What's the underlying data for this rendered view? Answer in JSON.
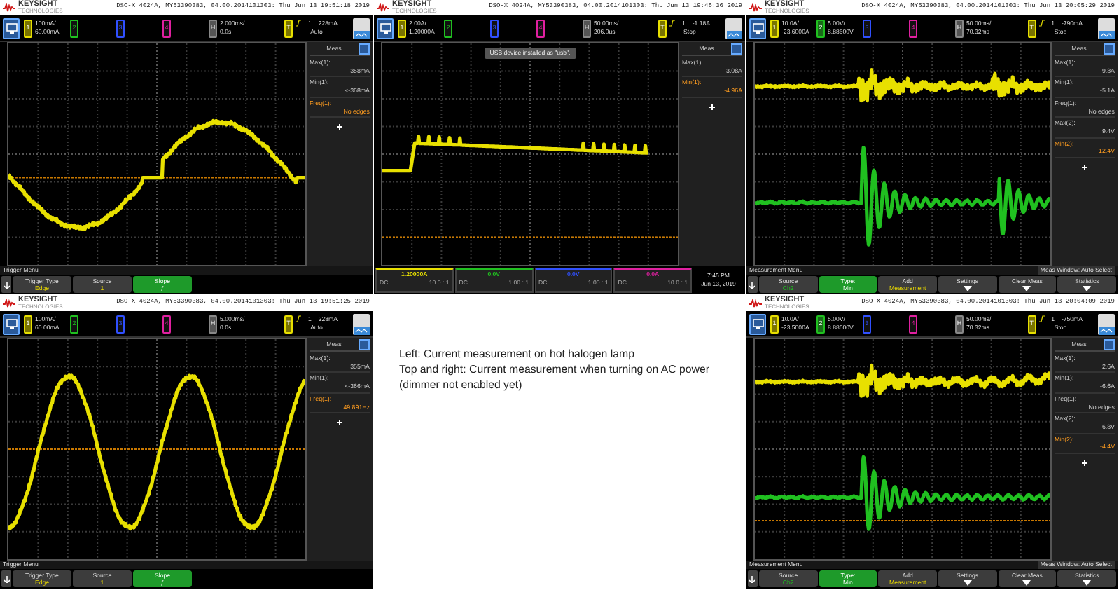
{
  "screenshots": [
    {
      "logo": {
        "brand": "KEYSIGHT",
        "tagline": "TECHNOLOGIES"
      },
      "title": "DSO-X 4024A, MY53390383, 04.00.2014101303: Thu Jun 13 19:51:18 2019",
      "channels": [
        {
          "label": "1",
          "on": true,
          "color": "#e8e000",
          "values": [
            "100mA/",
            "60.00mA"
          ]
        },
        {
          "label": "2",
          "on": false,
          "color": "#20c020"
        },
        {
          "label": "3",
          "on": false,
          "color": "#3050ff"
        },
        {
          "label": "4",
          "on": false,
          "color": "#e020a0"
        }
      ],
      "horizontal": {
        "label": "H",
        "values": [
          "2.000ms/",
          "0.0s"
        ]
      },
      "trigger": {
        "label": "T",
        "source": "1",
        "level": "228mA",
        "mode": "Auto"
      },
      "measurements": {
        "title": "Meas",
        "items": [
          {
            "label": "Max(1):",
            "value": "358mA",
            "highlighted": false
          },
          {
            "label": "Min(1):",
            "value": "<-368mA",
            "highlighted": false
          },
          {
            "label": "Freq(1):",
            "value": "No edges",
            "highlighted": true
          }
        ]
      },
      "traces": [
        {
          "kind": "stepped_sine",
          "color": "#e8e000"
        }
      ],
      "menu": {
        "title": "Trigger Menu",
        "softkeys": [
          {
            "label": "Trigger Type",
            "value": "Edge",
            "selected": false,
            "submenu": false
          },
          {
            "label": "Source",
            "value": "1",
            "selected": false,
            "submenu": false
          },
          {
            "label": "Slope",
            "value": "ƒ",
            "selected": true,
            "submenu": false
          }
        ]
      }
    },
    {
      "logo": {
        "brand": "KEYSIGHT",
        "tagline": "TECHNOLOGIES"
      },
      "title": "DSO-X 4024A, MY53390383, 04.00.2014101303: Thu Jun 13 19:46:36 2019",
      "channels": [
        {
          "label": "1",
          "on": true,
          "color": "#e8e000",
          "values": [
            "2.00A/",
            "1.20000A"
          ]
        },
        {
          "label": "2",
          "on": false,
          "color": "#20c020"
        },
        {
          "label": "3",
          "on": false,
          "color": "#3050ff"
        },
        {
          "label": "4",
          "on": false,
          "color": "#e020a0"
        }
      ],
      "horizontal": {
        "label": "H",
        "values": [
          "50.00ms/",
          "206.0us"
        ]
      },
      "trigger": {
        "label": "T",
        "source": "1",
        "level": "-1.18A",
        "mode": "Stop"
      },
      "toast": "USB device installed as \"usb\".",
      "measurements": {
        "title": "Meas",
        "items": [
          {
            "label": "Max(1):",
            "value": "3.08A",
            "highlighted": false
          },
          {
            "label": "Min(1):",
            "value": "-4.96A",
            "highlighted": true
          }
        ]
      },
      "traces": [
        {
          "kind": "inrush",
          "color": "#e8e000"
        }
      ],
      "status_bar": {
        "channels": [
          {
            "value": "1.20000A",
            "coupling": "DC",
            "probe": "10.0 : 1",
            "color": "#e8e000"
          },
          {
            "value": "0.0V",
            "coupling": "DC",
            "probe": "1.00 : 1",
            "color": "#20c020"
          },
          {
            "value": "0.0V",
            "coupling": "DC",
            "probe": "1.00 : 1",
            "color": "#3050ff"
          },
          {
            "value": "0.0A",
            "coupling": "DC",
            "probe": "10.0 : 1",
            "color": "#e020a0"
          }
        ],
        "time": "7:45 PM",
        "date": "Jun 13, 2019"
      }
    },
    {
      "logo": {
        "brand": "KEYSIGHT",
        "tagline": "TECHNOLOGIES"
      },
      "title": "DSO-X 4024A, MY53390383, 04.00.2014101303: Thu Jun 13 20:05:29 2019",
      "channels": [
        {
          "label": "1",
          "on": true,
          "color": "#e8e000",
          "values": [
            "10.0A/",
            "-23.6000A"
          ]
        },
        {
          "label": "2",
          "on": true,
          "color": "#20c020",
          "values": [
            "5.00V/",
            "8.88600V"
          ]
        },
        {
          "label": "3",
          "on": false,
          "color": "#3050ff"
        },
        {
          "label": "4",
          "on": false,
          "color": "#e020a0"
        }
      ],
      "horizontal": {
        "label": "H",
        "values": [
          "50.00ms/",
          "70.32ms"
        ]
      },
      "trigger": {
        "label": "T",
        "source": "1",
        "level": "-790mA",
        "mode": "Stop"
      },
      "measurements": {
        "title": "Meas",
        "items": [
          {
            "label": "Max(1):",
            "value": "9.3A",
            "highlighted": false
          },
          {
            "label": "Min(1):",
            "value": "-5.1A",
            "highlighted": false
          },
          {
            "label": "Freq(1):",
            "value": "No edges",
            "highlighted": false
          },
          {
            "label": "Max(2):",
            "value": "9.4V",
            "highlighted": false
          },
          {
            "label": "Min(2):",
            "value": "-12.4V",
            "highlighted": true
          }
        ]
      },
      "traces": [
        {
          "kind": "double_noise_burst",
          "color": "#e8e000"
        },
        {
          "kind": "double_ringing",
          "color": "#20c020"
        }
      ],
      "menu": {
        "title": "Measurement Menu",
        "status": "Meas Window: Auto Select",
        "softkeys": [
          {
            "label": "Source",
            "value": "Ch2",
            "selected": false,
            "submenu": false
          },
          {
            "label": "Type:",
            "value": "Min",
            "selected": true,
            "submenu": false
          },
          {
            "label": "Add",
            "value": "Measurement",
            "selected": false,
            "submenu": false
          },
          {
            "label": "Settings",
            "selected": false,
            "submenu": true
          },
          {
            "label": "Clear Meas",
            "selected": false,
            "submenu": true
          },
          {
            "label": "Statistics",
            "selected": false,
            "submenu": true
          }
        ]
      }
    },
    {
      "logo": {
        "brand": "KEYSIGHT",
        "tagline": "TECHNOLOGIES"
      },
      "title": "DSO-X 4024A, MY53390383, 04.00.2014101303: Thu Jun 13 19:51:25 2019",
      "channels": [
        {
          "label": "1",
          "on": true,
          "color": "#e8e000",
          "values": [
            "100mA/",
            "60.00mA"
          ]
        },
        {
          "label": "2",
          "on": false,
          "color": "#20c020"
        },
        {
          "label": "3",
          "on": false,
          "color": "#3050ff"
        },
        {
          "label": "4",
          "on": false,
          "color": "#e020a0"
        }
      ],
      "horizontal": {
        "label": "H",
        "values": [
          "5.000ms/",
          "0.0s"
        ]
      },
      "trigger": {
        "label": "T",
        "source": "1",
        "level": "228mA",
        "mode": "Auto"
      },
      "measurements": {
        "title": "Meas",
        "items": [
          {
            "label": "Max(1):",
            "value": "355mA",
            "highlighted": false
          },
          {
            "label": "Min(1):",
            "value": "<-366mA",
            "highlighted": false
          },
          {
            "label": "Freq(1):",
            "value": "49.891Hz",
            "highlighted": true
          }
        ]
      },
      "traces": [
        {
          "kind": "sine",
          "color": "#e8e000"
        }
      ],
      "menu": {
        "title": "Trigger Menu",
        "softkeys": [
          {
            "label": "Trigger Type",
            "value": "Edge",
            "selected": false,
            "submenu": false
          },
          {
            "label": "Source",
            "value": "1",
            "selected": false,
            "submenu": false
          },
          {
            "label": "Slope",
            "value": "ƒ",
            "selected": true,
            "submenu": false
          }
        ]
      }
    },
    {
      "logo": {
        "brand": "KEYSIGHT",
        "tagline": "TECHNOLOGIES"
      },
      "title": "DSO-X 4024A, MY53390383, 04.00.2014101303: Thu Jun 13 20:04:09 2019",
      "channels": [
        {
          "label": "1",
          "on": true,
          "color": "#e8e000",
          "values": [
            "10.0A/",
            "-23.5000A"
          ]
        },
        {
          "label": "2",
          "on": true,
          "color": "#20c020",
          "values": [
            "5.00V/",
            "8.88600V"
          ]
        },
        {
          "label": "3",
          "on": false,
          "color": "#3050ff"
        },
        {
          "label": "4",
          "on": false,
          "color": "#e020a0"
        }
      ],
      "horizontal": {
        "label": "H",
        "values": [
          "50.00ms/",
          "70.32ms"
        ]
      },
      "trigger": {
        "label": "T",
        "source": "1",
        "level": "-750mA",
        "mode": "Stop"
      },
      "measurements": {
        "title": "Meas",
        "items": [
          {
            "label": "Max(1):",
            "value": "2.6A",
            "highlighted": false
          },
          {
            "label": "Min(1):",
            "value": "-6.6A",
            "highlighted": false
          },
          {
            "label": "Freq(1):",
            "value": "No edges",
            "highlighted": false
          },
          {
            "label": "Max(2):",
            "value": "6.8V",
            "highlighted": false
          },
          {
            "label": "Min(2):",
            "value": "-4.4V",
            "highlighted": true
          }
        ]
      },
      "traces": [
        {
          "kind": "noise_burst",
          "color": "#e8e000"
        },
        {
          "kind": "ringing",
          "color": "#20c020"
        }
      ],
      "menu": {
        "title": "Measurement Menu",
        "status": "Meas Window: Auto Select",
        "softkeys": [
          {
            "label": "Source",
            "value": "Ch2",
            "selected": false,
            "submenu": false
          },
          {
            "label": "Type:",
            "value": "Min",
            "selected": true,
            "submenu": false
          },
          {
            "label": "Add",
            "value": "Measurement",
            "selected": false,
            "submenu": false
          },
          {
            "label": "Settings",
            "selected": false,
            "submenu": true
          },
          {
            "label": "Clear Meas",
            "selected": false,
            "submenu": true
          },
          {
            "label": "Statistics",
            "selected": false,
            "submenu": true
          }
        ]
      }
    }
  ],
  "caption": [
    "Left: Current measurement on hot halogen lamp",
    "Top and right: Current measurement when turning on AC power (dimmer not enabled yet)"
  ]
}
